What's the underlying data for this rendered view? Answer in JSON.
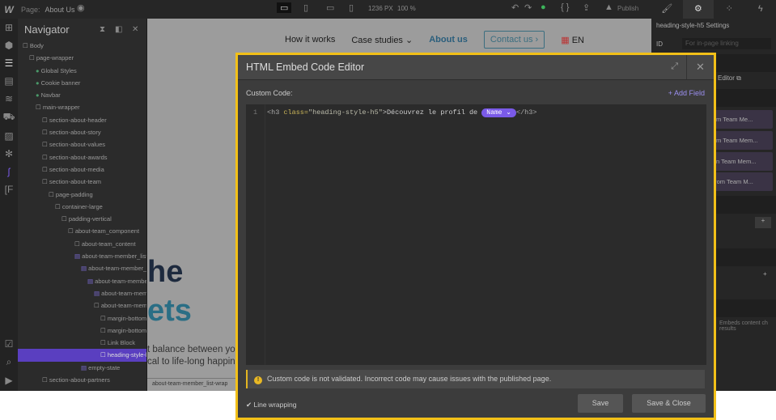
{
  "topbar": {
    "logo": "W",
    "page_label": "Page:",
    "page_name": "About Us",
    "width": "1236 PX",
    "zoom": "100 %",
    "publish": "Publish"
  },
  "navigator": {
    "title": "Navigator",
    "items": [
      {
        "label": "Body",
        "depth": 0
      },
      {
        "label": "page-wrapper",
        "depth": 1
      },
      {
        "label": "Global Styles",
        "depth": 2,
        "type": "symbol"
      },
      {
        "label": "Cookie banner",
        "depth": 2,
        "type": "symbol"
      },
      {
        "label": "Navbar",
        "depth": 2,
        "type": "symbol"
      },
      {
        "label": "main-wrapper",
        "depth": 2
      },
      {
        "label": "section-about-header",
        "depth": 3
      },
      {
        "label": "section-about-story",
        "depth": 3
      },
      {
        "label": "section-about-values",
        "depth": 3
      },
      {
        "label": "section-about-awards",
        "depth": 3
      },
      {
        "label": "section-about-media",
        "depth": 3
      },
      {
        "label": "section-about-team",
        "depth": 3
      },
      {
        "label": "page-padding",
        "depth": 4
      },
      {
        "label": "container-large",
        "depth": 5
      },
      {
        "label": "padding-vertical",
        "depth": 6
      },
      {
        "label": "about-team_component",
        "depth": 7
      },
      {
        "label": "about-team_content",
        "depth": 8
      },
      {
        "label": "about-team-member_list",
        "depth": 8,
        "type": "cms"
      },
      {
        "label": "about-team-member_l",
        "depth": 9,
        "type": "cms"
      },
      {
        "label": "about-team-member",
        "depth": 10,
        "type": "cms"
      },
      {
        "label": "about-team-mem",
        "depth": 11,
        "type": "cms"
      },
      {
        "label": "about-team-mem",
        "depth": 11
      },
      {
        "label": "margin-bottom",
        "depth": 12
      },
      {
        "label": "margin-bottom",
        "depth": 12
      },
      {
        "label": "Link Block",
        "depth": 12
      },
      {
        "label": "heading-style-h5",
        "depth": 12,
        "selected": true
      },
      {
        "label": "empty-state",
        "depth": 9,
        "type": "cms"
      },
      {
        "label": "section-about-partners",
        "depth": 3
      }
    ]
  },
  "site": {
    "nav": [
      "How it works",
      "Case studies",
      "About us"
    ],
    "contact": "Contact us",
    "lang": "EN",
    "heading1": "he",
    "heading2": "ets",
    "para1": "t balance between yo",
    "para2": "cal to life-long happin",
    "breadcrumb": "about-team-member_list-wrap"
  },
  "settings": {
    "title": "heading-style-h5 Settings",
    "id_label": "ID",
    "id_placeholder": "For in-page linking",
    "sec1": "ttings",
    "editor": "Editor",
    "sec2": "ttings",
    "chips": [
      "m  Team Me...",
      "m  Team Mem...",
      "n  Team Mem...",
      "from  Team M..."
    ],
    "sec3": "lity",
    "sec4": "s",
    "sec5": "tings",
    "note": "Embeds content ch results"
  },
  "modal": {
    "title": "HTML Embed Code Editor",
    "custom_code_label": "Custom Code:",
    "add_field": "+ Add Field",
    "line_number": "1",
    "code": {
      "open_tag": "<h3 ",
      "attr": "class=",
      "value": "\"heading-style-h5\"",
      "text": ">Découvrez le profil de ",
      "field": "Name",
      "close_tag": "</h3>"
    },
    "warning": "Custom code is not validated. Incorrect code may cause issues with the published page.",
    "line_wrapping": "Line wrapping",
    "line_wrapping_checked": true,
    "save": "Save",
    "save_close": "Save & Close"
  },
  "colors": {
    "accent": "#7a5ae8",
    "highlight_border": "#f2c018",
    "selected": "#5a3fc0"
  }
}
